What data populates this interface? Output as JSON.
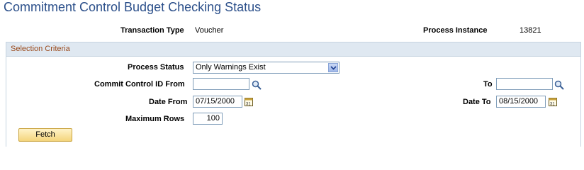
{
  "page": {
    "title": "Commitment Control Budget Checking Status"
  },
  "header": {
    "transaction_type_label": "Transaction Type",
    "transaction_type_value": "Voucher",
    "process_instance_label": "Process Instance",
    "process_instance_value": "13821"
  },
  "selection": {
    "title": "Selection Criteria",
    "process_status_label": "Process Status",
    "process_status_value": "Only Warnings Exist",
    "commit_from_label": "Commit Control ID From",
    "commit_from_value": "",
    "to_label": "To",
    "to_value": "",
    "date_from_label": "Date From",
    "date_from_value": "07/15/2000",
    "date_to_label": "Date To",
    "date_to_value": "08/15/2000",
    "max_rows_label": "Maximum Rows",
    "max_rows_value": "100",
    "fetch_label": "Fetch"
  },
  "icons": {
    "lookup": "magnifier-icon",
    "calendar": "calendar-icon",
    "dropdown": "chevron-down-icon"
  },
  "colors": {
    "title": "#2b4f8a",
    "group_header_bg": "#dfe8f1",
    "group_title": "#9a4a1c",
    "button_bg": "#f4d57c"
  }
}
